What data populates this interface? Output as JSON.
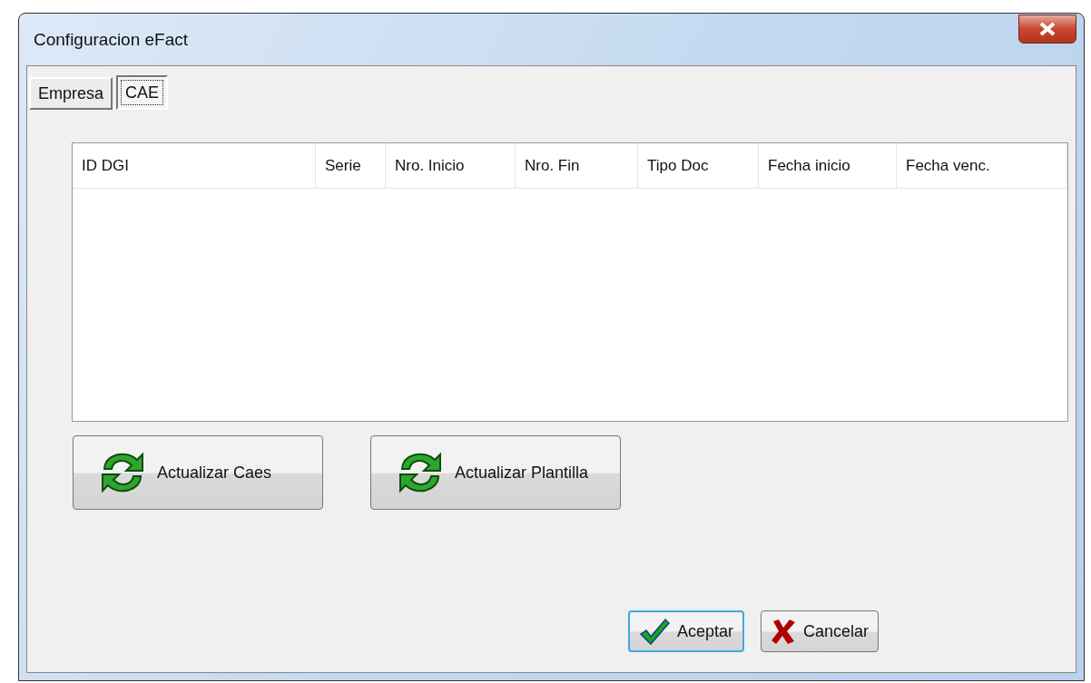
{
  "window": {
    "title": "Configuracion eFact"
  },
  "tabs": [
    {
      "label": "Empresa",
      "selected": false
    },
    {
      "label": "CAE",
      "selected": true
    }
  ],
  "table": {
    "columns": [
      "ID DGI",
      "Serie",
      "Nro. Inicio",
      "Nro. Fin",
      "Tipo Doc",
      "Fecha inicio",
      "Fecha venc."
    ]
  },
  "action_buttons": [
    {
      "label": "Actualizar Caes",
      "kind": "refresh"
    },
    {
      "label": "Actualizar Plantilla",
      "kind": "refresh"
    }
  ],
  "dialog_buttons": [
    {
      "label": "Aceptar",
      "kind": "ok",
      "default": true
    },
    {
      "label": "Cancelar",
      "kind": "cancel",
      "default": false
    }
  ]
}
